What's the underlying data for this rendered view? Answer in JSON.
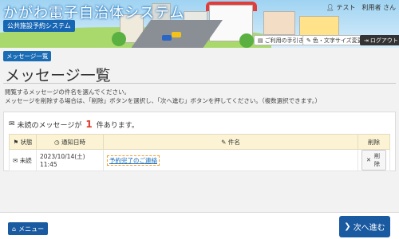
{
  "header": {
    "title": "かがわ電子自治体システム",
    "subtitle": "公共施設予約システム",
    "user": "テスト　利用者 さん",
    "guide_label": "ご利用の手引き",
    "color_label": "色・文字サイズ変更",
    "logout_label": "ログアウト"
  },
  "breadcrumb": "メッセージ一覧",
  "page": {
    "title": "メッセージ一覧",
    "desc_line1": "閲覧するメッセージの件名を選んでください。",
    "desc_line2": "メッセージを削除する場合は、「削除」ボタンを選択し、「次へ進む」ボタンを押してください。（複数選択できます。）"
  },
  "unread": {
    "prefix": "未読のメッセージが",
    "count": "1",
    "suffix": "件あります。"
  },
  "table": {
    "headers": {
      "status": "状態",
      "date": "通知日時",
      "subject": "件名",
      "delete": "削除"
    },
    "rows": [
      {
        "status": "未読",
        "date": "2023/10/14(土) 11:45",
        "subject": "予約完了のご連絡",
        "delete": "削除"
      }
    ]
  },
  "footer": {
    "menu_label": "メニュー",
    "next_label": "次へ進む"
  },
  "colors": {
    "primary": "#1a5aa0",
    "accent": "#e03a2a",
    "table_header": "#fbf3d3"
  }
}
